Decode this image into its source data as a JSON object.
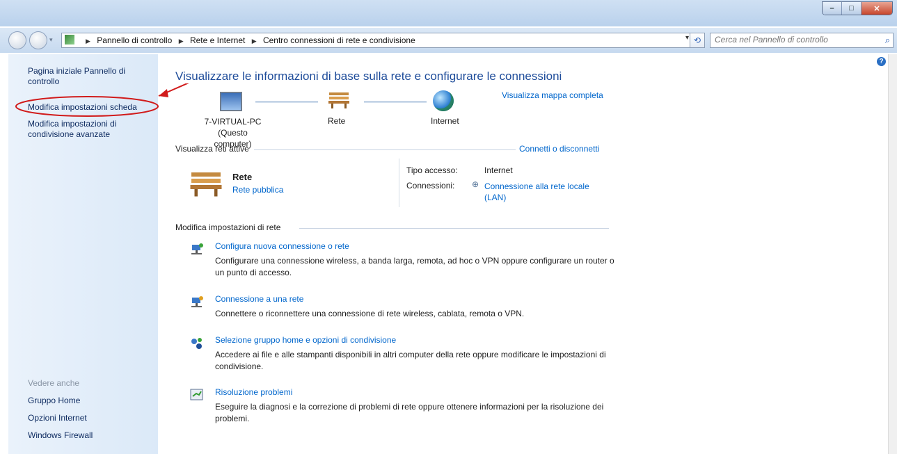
{
  "window": {
    "min_label": "–",
    "max_label": "□",
    "close_label": "✕"
  },
  "address": {
    "crumbs": [
      "Pannello di controllo",
      "Rete e Internet",
      "Centro connessioni di rete e condivisione"
    ],
    "dropdown": "▾",
    "refresh": "⟲"
  },
  "search": {
    "placeholder": "Cerca nel Pannello di controllo"
  },
  "sidebar": {
    "items": [
      {
        "label": "Pagina iniziale Pannello di\ncontrollo"
      },
      {
        "label": "Modifica impostazioni scheda"
      },
      {
        "label": "Modifica impostazioni di\ncondivisione avanzate"
      }
    ],
    "see_also_title": "Vedere anche",
    "see_also": [
      {
        "label": "Gruppo Home"
      },
      {
        "label": "Opzioni Internet"
      },
      {
        "label": "Windows Firewall"
      }
    ]
  },
  "main": {
    "title": "Visualizzare le informazioni di base sulla rete e configurare le connessioni",
    "map_link": "Visualizza mappa completa",
    "map": {
      "computer_name": "7-VIRTUAL-PC",
      "computer_note": "(Questo computer)",
      "network": "Rete",
      "internet": "Internet"
    },
    "active_header": "Visualizza reti attive",
    "connect_link": "Connetti o disconnetti",
    "active": {
      "name": "Rete",
      "type_link": "Rete pubblica",
      "access_label": "Tipo accesso:",
      "access_value": "Internet",
      "conn_label": "Connessioni:",
      "conn_value_1": "Connessione alla rete locale",
      "conn_value_2": "(LAN)"
    },
    "settings_header": "Modifica impostazioni di rete",
    "tasks": [
      {
        "title": "Configura nuova connessione o rete",
        "desc": "Configurare una connessione wireless, a banda larga, remota, ad hoc o VPN oppure configurare un router o un punto di accesso."
      },
      {
        "title": "Connessione a una rete",
        "desc": "Connettere o riconnettere una connessione di rete wireless, cablata, remota o VPN."
      },
      {
        "title": "Selezione gruppo home e opzioni di condivisione",
        "desc": "Accedere ai file e alle stampanti disponibili in altri computer della rete oppure modificare le impostazioni di condivisione."
      },
      {
        "title": "Risoluzione problemi",
        "desc": "Eseguire la diagnosi e la correzione di problemi di rete oppure ottenere informazioni per la risoluzione dei problemi."
      }
    ]
  }
}
